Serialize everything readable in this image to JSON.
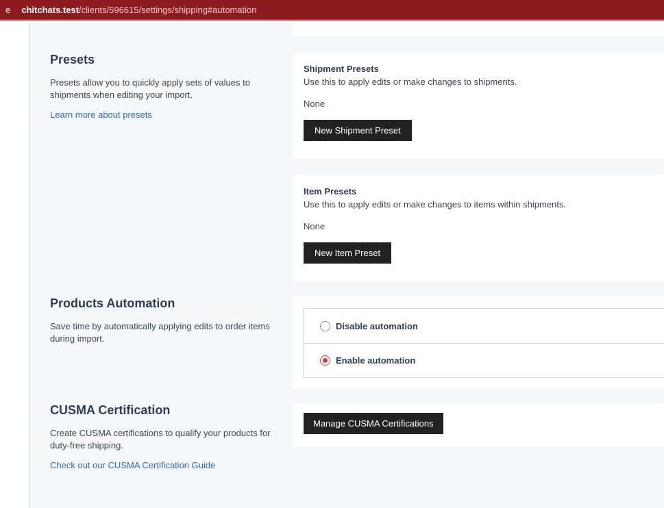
{
  "browser": {
    "lead": "e",
    "host": "chitchats.test",
    "path": "/clients/596615/settings/shipping#automation"
  },
  "presets": {
    "title": "Presets",
    "description": "Presets allow you to quickly apply sets of values to shipments when editing your import.",
    "learn_link": "Learn more about presets",
    "shipment": {
      "title": "Shipment Presets",
      "description": "Use this to apply edits or make changes to shipments.",
      "empty": "None",
      "button": "New Shipment Preset"
    },
    "item": {
      "title": "Item Presets",
      "description": "Use this to apply edits or make changes to items within shipments.",
      "empty": "None",
      "button": "New Item Preset"
    }
  },
  "products_automation": {
    "title": "Products Automation",
    "description": "Save time by automatically applying edits to order items during import.",
    "options": [
      {
        "label": "Disable automation",
        "selected": false
      },
      {
        "label": "Enable automation",
        "selected": true
      }
    ]
  },
  "cusma": {
    "title": "CUSMA Certification",
    "description": "Create CUSMA certifications to qualify your products for duty-free shipping.",
    "guide_link": "Check out our CUSMA Certification Guide",
    "button": "Manage CUSMA Certifications"
  },
  "colors": {
    "url_bar": "#8c1c1f",
    "button": "#222222",
    "link": "#2a67c4",
    "radio_selected": "#d33a34"
  }
}
